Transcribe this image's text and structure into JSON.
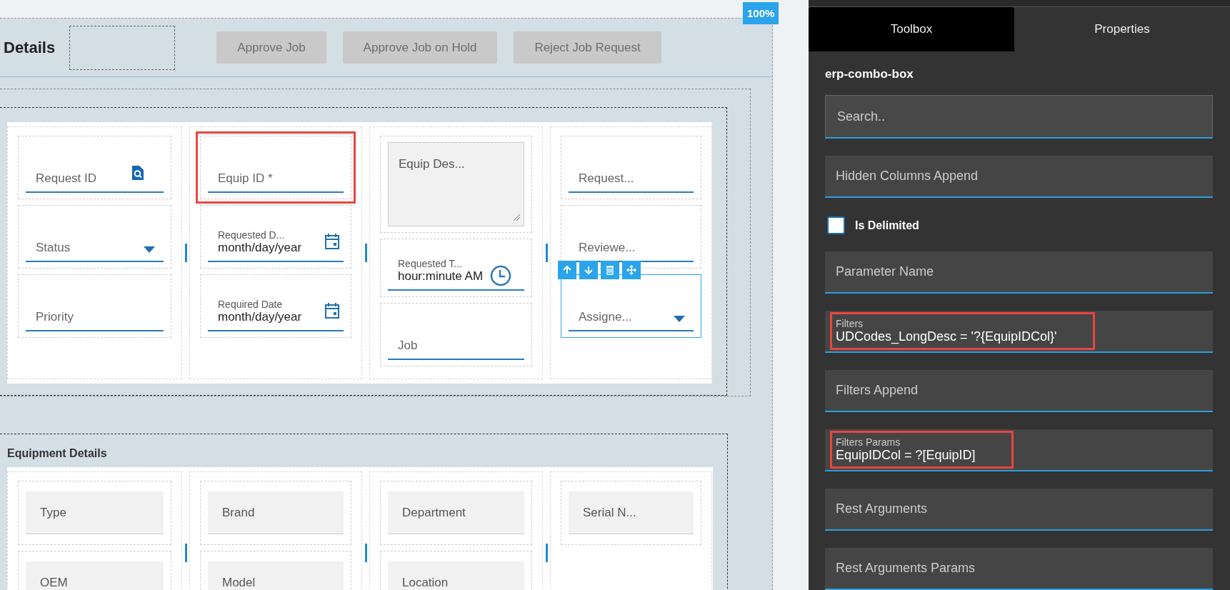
{
  "canvas": {
    "zoom_badge": "100%",
    "header": {
      "title": "Details",
      "buttons": [
        "Approve Job",
        "Approve Job on Hold",
        "Reject Job Request"
      ]
    },
    "request_section": {
      "columns": [
        [
          {
            "kind": "lookup",
            "label": "Request ID"
          },
          {
            "kind": "select",
            "label": "Status"
          },
          {
            "kind": "text",
            "label": "Priority"
          }
        ],
        [
          {
            "kind": "text",
            "label": "Equip ID *",
            "highlighted": true
          },
          {
            "kind": "date",
            "label": "Requested D...",
            "value": "month/day/year"
          },
          {
            "kind": "date",
            "label": "Required Date",
            "value": "month/day/year"
          }
        ],
        [
          {
            "kind": "textarea",
            "label": "Equip Des..."
          },
          {
            "kind": "time",
            "label": "Requested T...",
            "value": "hour:minute AM"
          },
          {
            "kind": "text",
            "label": "Job"
          }
        ],
        [
          {
            "kind": "text",
            "label": "Request..."
          },
          {
            "kind": "text",
            "label": "Reviewe..."
          },
          {
            "kind": "select",
            "label": "Assigne...",
            "selected": true
          }
        ]
      ]
    },
    "equipment_section": {
      "title": "Equipment Details",
      "columns": [
        [
          {
            "kind": "readonly",
            "label": "Type"
          },
          {
            "kind": "readonly",
            "label": "OEM"
          }
        ],
        [
          {
            "kind": "readonly",
            "label": "Brand"
          },
          {
            "kind": "readonly",
            "label": "Model"
          }
        ],
        [
          {
            "kind": "readonly",
            "label": "Department"
          },
          {
            "kind": "readonly",
            "label": "Location"
          }
        ],
        [
          {
            "kind": "readonly",
            "label": "Serial N..."
          }
        ]
      ]
    }
  },
  "panel": {
    "tabs": [
      {
        "label": "Toolbox",
        "selected": true
      },
      {
        "label": "Properties",
        "selected": false
      }
    ],
    "component": "erp-combo-box",
    "search": {
      "placeholder": "Search.."
    },
    "properties": [
      {
        "kind": "text",
        "label": "Hidden Columns Append"
      },
      {
        "kind": "checkbox",
        "label": "Is Delimited",
        "checked": false
      },
      {
        "kind": "text",
        "label": "Parameter Name"
      },
      {
        "kind": "text",
        "label": "Filters",
        "value": "UDCodes_LongDesc = '?{EquipIDCol}'",
        "highlighted": true
      },
      {
        "kind": "text",
        "label": "Filters Append"
      },
      {
        "kind": "text",
        "label": "Filters Params",
        "value": "EquipIDCol = ?[EquipID]",
        "highlighted": true
      },
      {
        "kind": "text",
        "label": "Rest Arguments"
      },
      {
        "kind": "text",
        "label": "Rest Arguments Params"
      }
    ]
  }
}
